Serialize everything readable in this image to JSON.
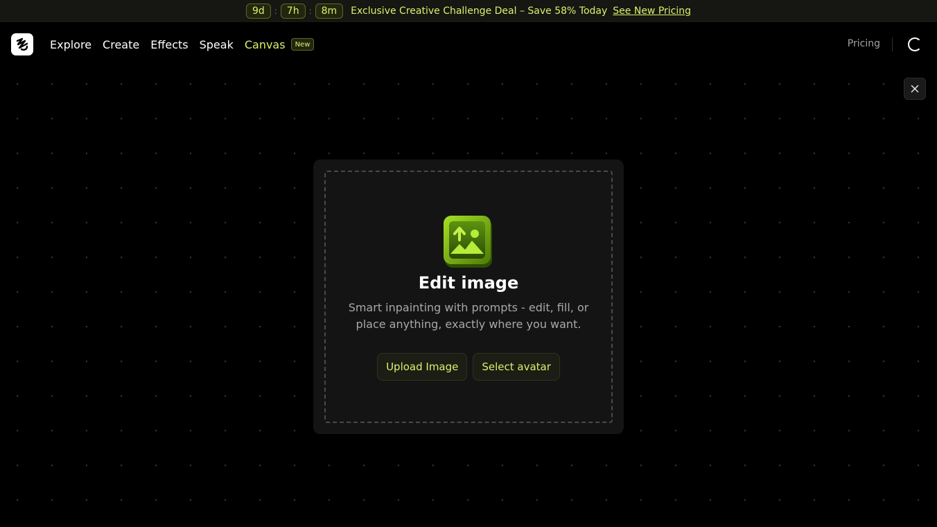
{
  "promo": {
    "timer": {
      "days": "9d",
      "hours": "7h",
      "minutes": "8m",
      "separator": ":"
    },
    "text": "Exclusive Creative Challenge Deal – Save 58% Today",
    "link": "See New Pricing"
  },
  "nav": {
    "items": [
      {
        "label": "Explore"
      },
      {
        "label": "Create"
      },
      {
        "label": "Effects"
      },
      {
        "label": "Speak"
      },
      {
        "label": "Canvas",
        "badge": "New"
      }
    ],
    "pricing": "Pricing"
  },
  "modal": {
    "title": "Edit image",
    "description": "Smart inpainting with prompts - edit, fill, or place anything, exactly where you want.",
    "upload_label": "Upload Image",
    "avatar_label": "Select avatar"
  },
  "colors": {
    "accent": "#d9f26b",
    "background": "#000000",
    "card": "#141414"
  },
  "icons": {
    "logo": "brand-logo-icon",
    "close": "close-icon",
    "hero": "image-upload-icon",
    "loading": "spinner-icon"
  }
}
